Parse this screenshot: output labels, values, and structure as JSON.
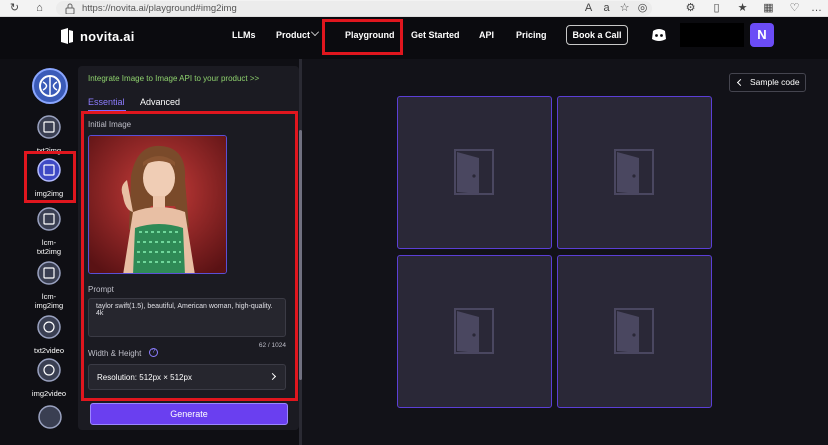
{
  "browser": {
    "url": "https://novita.ai/playground#img2img"
  },
  "nav": {
    "logo_text": "novita.ai",
    "links": [
      "LLMs",
      "Product",
      "Playground",
      "Get Started",
      "API",
      "Pricing"
    ],
    "book_call": "Book a Call",
    "avatar_letter": "N"
  },
  "rail": {
    "items": [
      "txt2img",
      "img2img",
      "lcm-\ntxt2img",
      "lcm-\nimg2img",
      "txt2video",
      "img2video"
    ]
  },
  "panel": {
    "promo": "Integrate Image to Image API to your product >>",
    "tabs": [
      "Essential",
      "Advanced"
    ],
    "initial_image_label": "Initial Image",
    "prompt_label": "Prompt",
    "prompt_value": "taylor swift(1.5), beautiful, American woman, high-quality. 4k",
    "prompt_count": "62 / 1024",
    "size_label": "Width & Height",
    "resolution": "Resolution: 512px × 512px",
    "generate": "Generate"
  },
  "output": {
    "sample_code": "Sample code"
  },
  "colors": {
    "accent": "#6a3ff0",
    "highlight_box": "#e0161e",
    "promo": "#8fd36e"
  }
}
